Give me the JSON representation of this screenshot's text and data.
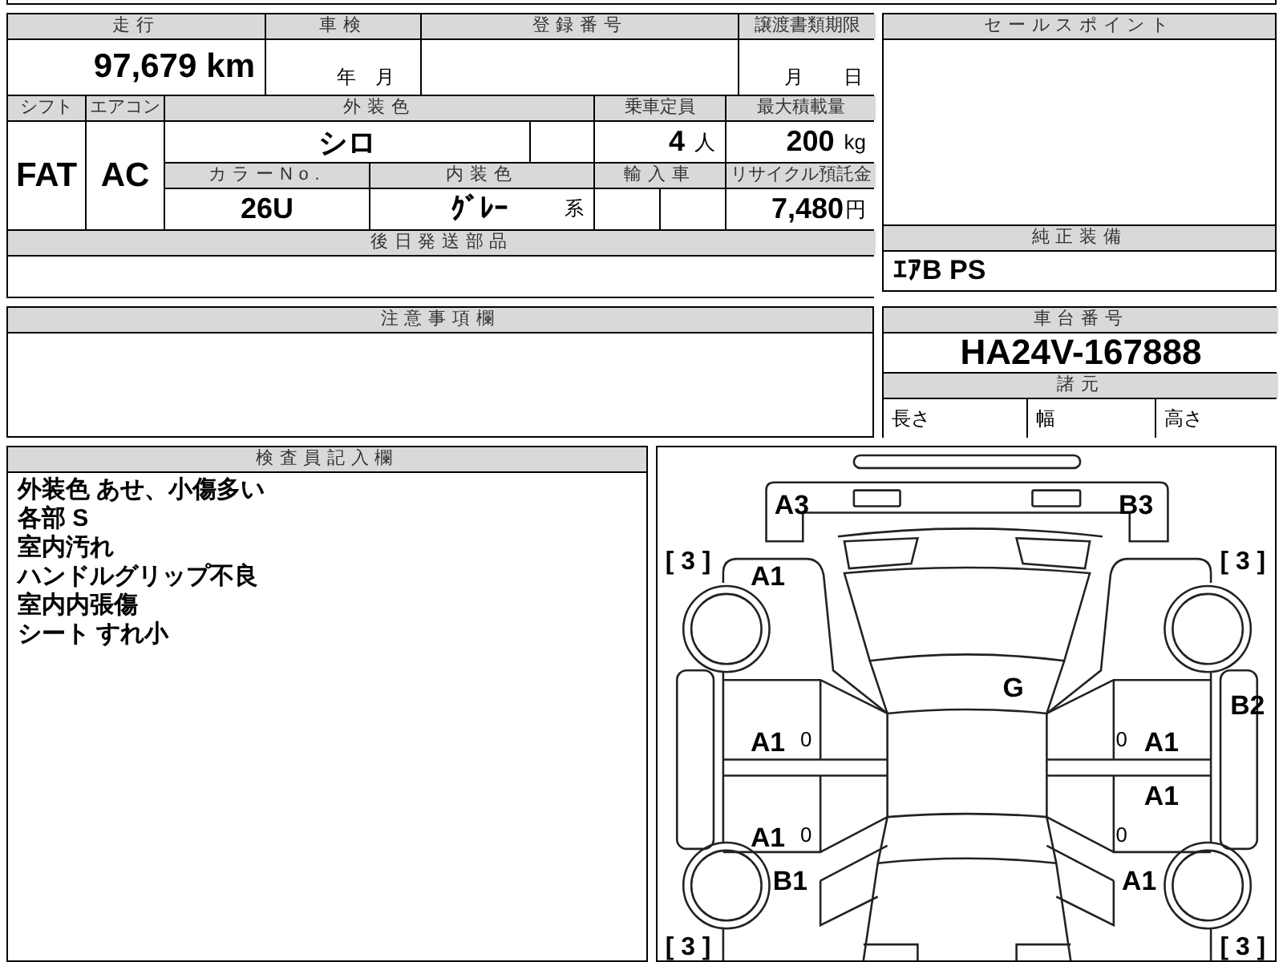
{
  "mileage": {
    "label": "走行",
    "value": "97,679",
    "unit": "km"
  },
  "inspection": {
    "label": "車検",
    "year_unit": "年",
    "month_unit": "月"
  },
  "registration_number": {
    "label": "登録番号"
  },
  "transfer_deadline": {
    "label": "譲渡書類期限",
    "month_unit": "月",
    "day_unit": "日"
  },
  "shift": {
    "label": "シフト",
    "value": "FAT"
  },
  "air_conditioner": {
    "label": "エアコン",
    "value": "AC"
  },
  "exterior_color": {
    "label": "外装色",
    "value": "シロ"
  },
  "capacity": {
    "label": "乗車定員",
    "value": "4",
    "unit": "人"
  },
  "max_load": {
    "label": "最大積載量",
    "value": "200",
    "unit": "kg"
  },
  "color_no": {
    "label": "カラーNo.",
    "value": "26U"
  },
  "interior_color": {
    "label": "内装色",
    "value": "ｸﾞﾚｰ",
    "suffix": "系"
  },
  "imported": {
    "label": "輸入車"
  },
  "recycling_fee": {
    "label": "リサイクル預託金",
    "value": "7,480",
    "unit": "円"
  },
  "later_parts": {
    "label": "後日発送部品"
  },
  "sales_points": {
    "label": "セールスポイント"
  },
  "standard_equipment": {
    "label": "純正装備",
    "value": "ｴｱB PS"
  },
  "notes": {
    "label": "注意事項欄"
  },
  "chassis_number": {
    "label": "車台番号",
    "value": "HA24V-167888"
  },
  "specifications": {
    "label": "諸元",
    "items": [
      "長さ",
      "幅",
      "高さ"
    ]
  },
  "inspector_notes": {
    "label": "検査員記入欄",
    "lines": [
      "外装色 あせ、小傷多い",
      "各部 S",
      "室内汚れ",
      "ハンドルグリップ不良",
      "室内内張傷",
      "シート すれ小"
    ]
  },
  "damage_map": {
    "marks": [
      {
        "text": "A3",
        "kind": "code"
      },
      {
        "text": "B3",
        "kind": "code"
      },
      {
        "text": "[ 3 ]",
        "kind": "tire"
      },
      {
        "text": "[ 3 ]",
        "kind": "tire"
      },
      {
        "text": "A1",
        "kind": "code"
      },
      {
        "text": "G",
        "kind": "code"
      },
      {
        "text": "B2",
        "kind": "code"
      },
      {
        "text": "A1",
        "kind": "code"
      },
      {
        "text": "0",
        "kind": "small"
      },
      {
        "text": "0",
        "kind": "small"
      },
      {
        "text": "A1",
        "kind": "code"
      },
      {
        "text": "A1",
        "kind": "code"
      },
      {
        "text": "A1",
        "kind": "code"
      },
      {
        "text": "0",
        "kind": "small"
      },
      {
        "text": "0",
        "kind": "small"
      },
      {
        "text": "B1",
        "kind": "code"
      },
      {
        "text": "A1",
        "kind": "code"
      },
      {
        "text": "[ 3 ]",
        "kind": "tire"
      },
      {
        "text": "[ 3 ]",
        "kind": "tire"
      }
    ]
  }
}
